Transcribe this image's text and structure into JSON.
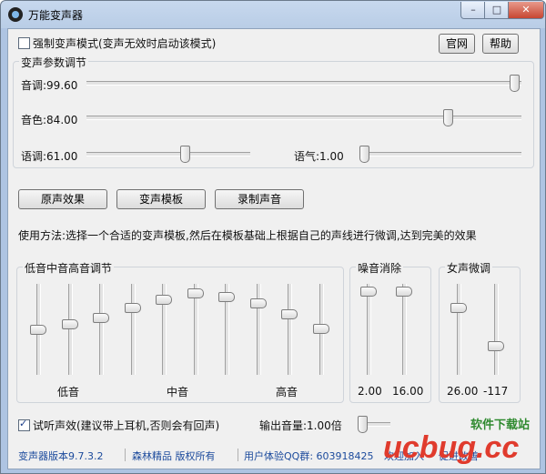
{
  "window": {
    "title": "万能变声器"
  },
  "force_mode": {
    "checked": false,
    "label": "强制变声模式(变声无效时启动该模式)"
  },
  "top_buttons": {
    "website": "官网",
    "help": "帮助"
  },
  "params": {
    "title": "变声参数调节",
    "pitch_label": "音调:99.60",
    "pitch_level": 99.6,
    "timbre_label": "音色:84.00",
    "timbre_level": 84.0,
    "tone_label": "语调:61.00",
    "tone_level": 61.0,
    "breath_label": "语气:1.00",
    "breath_level": 1.0
  },
  "actions": {
    "original": "原声效果",
    "templates": "变声模板",
    "record": "录制声音"
  },
  "instructions": "使用方法:选择一个合适的变声模板,然后在模板基础上根据自己的声线进行微调,达到完美的效果",
  "eq": {
    "title": "低音中音高音调节",
    "labels": {
      "bass": "低音",
      "mid": "中音",
      "treble": "高音"
    },
    "band_levels": [
      0.5,
      0.56,
      0.64,
      0.76,
      0.86,
      0.94,
      0.9,
      0.82,
      0.68,
      0.51
    ]
  },
  "noise": {
    "title": "噪音消除",
    "values": [
      "2.00",
      "16.00"
    ],
    "levels": [
      0.97,
      0.97
    ]
  },
  "female": {
    "title": "女声微调",
    "values": [
      "26.00",
      "-117"
    ],
    "levels": [
      0.76,
      0.29
    ]
  },
  "monitor": {
    "checked": true,
    "label": "试听声效(建议带上耳机,否则会有回声)",
    "volume_label": "输出音量:1.00倍",
    "volume_level": 0.0
  },
  "status": {
    "version": "变声器版本9.7.3.2",
    "company": "森林精品 版权所有",
    "qq": "用户体验QQ群: 603918425",
    "join": "欢迎加入",
    "feedback": "促进改善"
  },
  "watermark": {
    "brand": "ucbug.cc",
    "tagline": "软件下载站"
  }
}
